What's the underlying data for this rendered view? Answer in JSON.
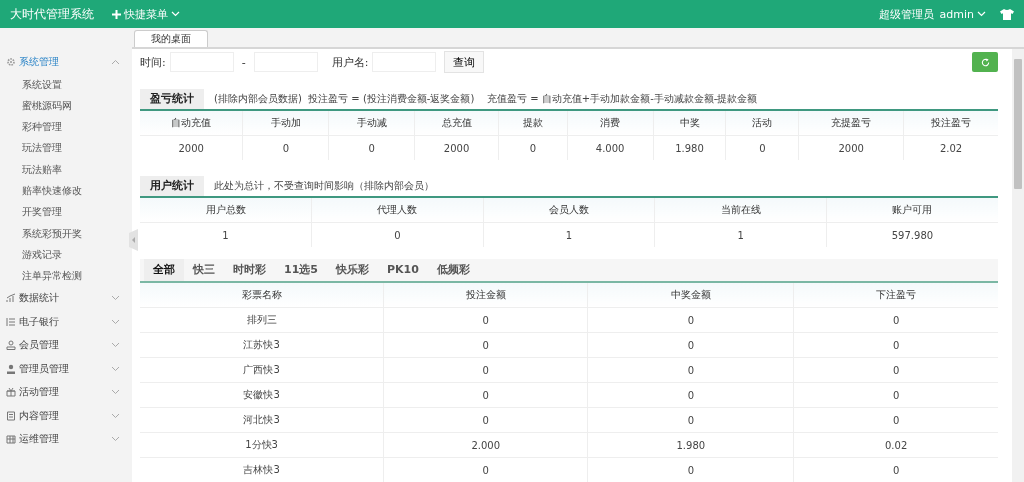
{
  "topbar": {
    "title": "大时代管理系统",
    "quick_menu": "快捷菜单",
    "role": "超级管理员",
    "user": "admin"
  },
  "sidebar": {
    "items": [
      {
        "label": "系统管理",
        "expanded": true,
        "children": [
          {
            "label": "系统设置"
          },
          {
            "label": "蜜桃源码网"
          },
          {
            "label": "彩种管理"
          },
          {
            "label": "玩法管理"
          },
          {
            "label": "玩法赔率"
          },
          {
            "label": "赔率快速修改"
          },
          {
            "label": "开奖管理"
          },
          {
            "label": "系统彩预开奖"
          },
          {
            "label": "游戏记录"
          },
          {
            "label": "注单异常检测"
          }
        ]
      },
      {
        "label": "数据统计",
        "expanded": false
      },
      {
        "label": "电子银行",
        "expanded": false
      },
      {
        "label": "会员管理",
        "expanded": false
      },
      {
        "label": "管理员管理",
        "expanded": false
      },
      {
        "label": "活动管理",
        "expanded": false
      },
      {
        "label": "内容管理",
        "expanded": false
      },
      {
        "label": "运维管理",
        "expanded": false
      }
    ]
  },
  "tabs": [
    {
      "label": "我的桌面",
      "selected": true
    }
  ],
  "query": {
    "time_label": "时间:",
    "separator": "-",
    "user_label": "用户名:",
    "button": "查询"
  },
  "profit_stats": {
    "title": "盈亏统计",
    "note": "(排除内部会员数据)  投注盈亏 = (投注消费金额-返奖金额)    充值盈亏 = 自动充值+手动加款金额-手动减款金额-提款金额",
    "columns": [
      "自动充值",
      "手动加",
      "手动减",
      "总充值",
      "提款",
      "消费",
      "中奖",
      "活动",
      "充提盈亏",
      "投注盈亏"
    ],
    "rows": [
      [
        "2000",
        "0",
        "0",
        "2000",
        "0",
        "4.000",
        "1.980",
        "0",
        "2000",
        "2.02"
      ]
    ]
  },
  "user_stats": {
    "title": "用户统计",
    "note": "此处为总计，不受查询时间影响（排除内部会员）",
    "columns": [
      "用户总数",
      "代理人数",
      "会员人数",
      "当前在线",
      "账户可用"
    ],
    "rows": [
      [
        "1",
        "0",
        "1",
        "1",
        "597.980"
      ]
    ]
  },
  "lottery": {
    "tabs": [
      {
        "label": "全部",
        "selected": true
      },
      {
        "label": "快三",
        "selected": false
      },
      {
        "label": "时时彩",
        "selected": false
      },
      {
        "label": "11选5",
        "selected": false
      },
      {
        "label": "快乐彩",
        "selected": false
      },
      {
        "label": "PK10",
        "selected": false
      },
      {
        "label": "低频彩",
        "selected": false
      }
    ],
    "columns": [
      "彩票名称",
      "投注金额",
      "中奖金额",
      "下注盈亏"
    ],
    "rows": [
      [
        "排列三",
        "0",
        "0",
        "0"
      ],
      [
        "江苏快3",
        "0",
        "0",
        "0"
      ],
      [
        "广西快3",
        "0",
        "0",
        "0"
      ],
      [
        "安徽快3",
        "0",
        "0",
        "0"
      ],
      [
        "河北快3",
        "0",
        "0",
        "0"
      ],
      [
        "1分快3",
        "2.000",
        "1.980",
        "0.02"
      ],
      [
        "吉林快3",
        "0",
        "0",
        "0"
      ]
    ]
  }
}
